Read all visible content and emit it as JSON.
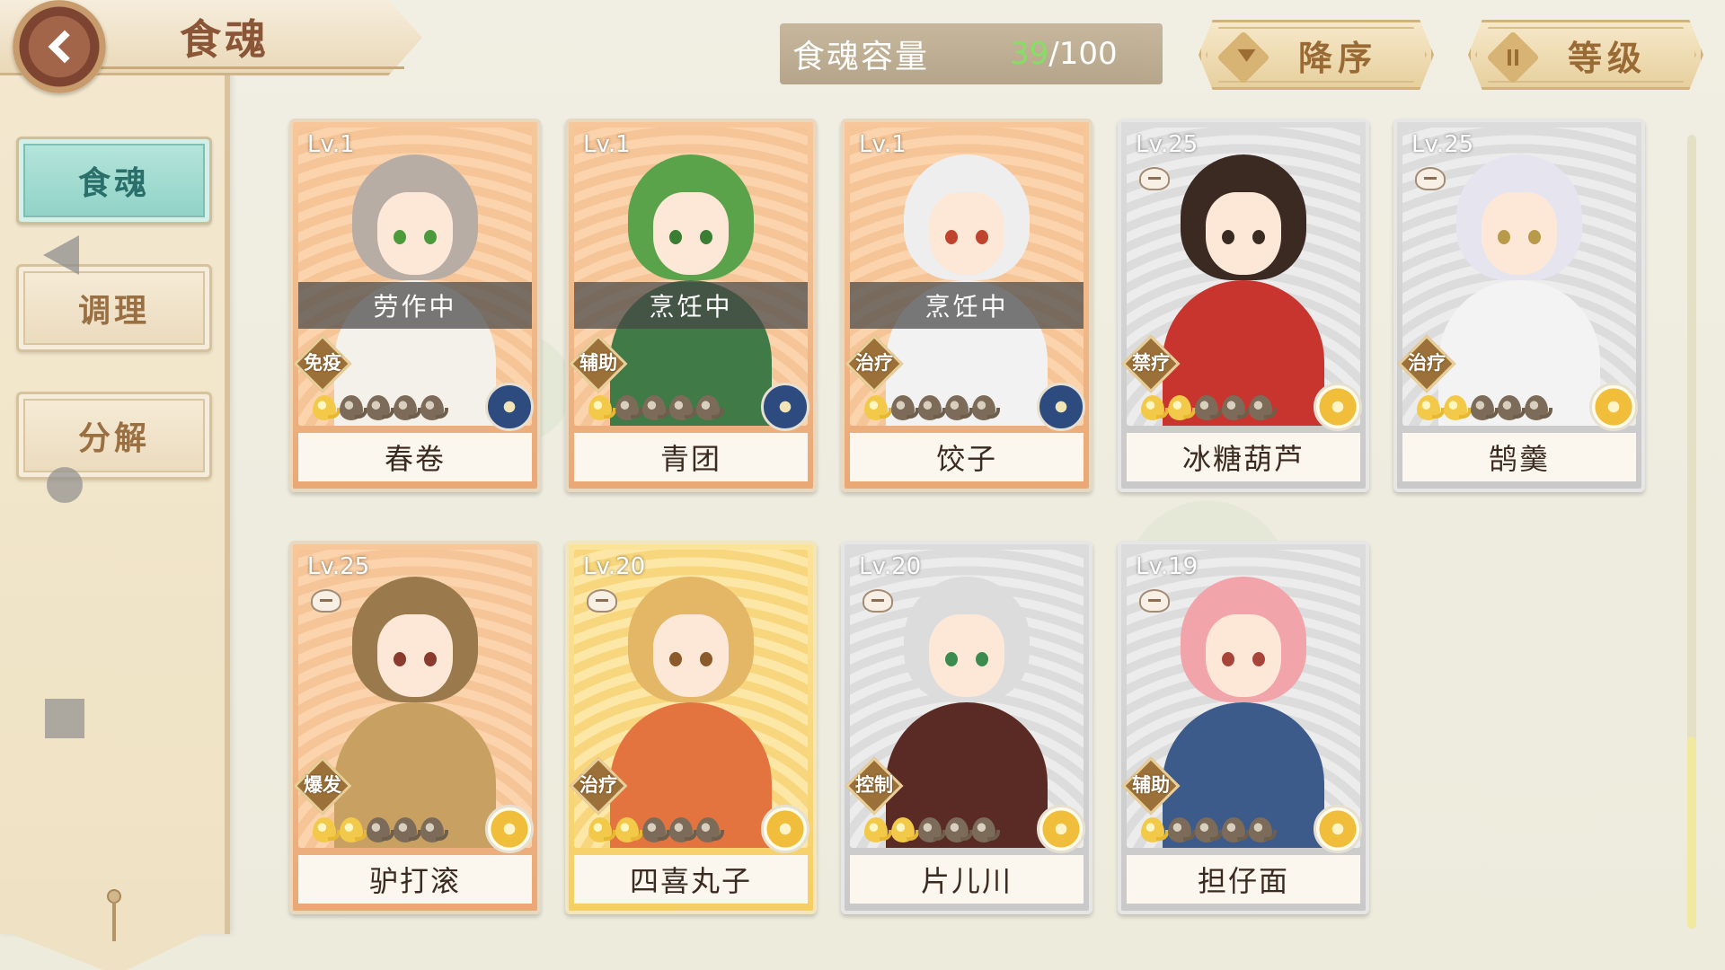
{
  "header": {
    "title": "食魂",
    "capacity_label": "食魂容量",
    "capacity_current": "39",
    "capacity_sep_max": "/100",
    "sort_label": "降序",
    "level_label": "等级"
  },
  "sidebar": {
    "items": [
      {
        "label": "食魂",
        "active": true
      },
      {
        "label": "调理",
        "active": false
      },
      {
        "label": "分解",
        "active": false
      }
    ]
  },
  "colors": {
    "accent_teal": "#8fd1c6",
    "capacity_green": "#7fe05c",
    "title_brown": "#8b5637"
  },
  "cards": [
    {
      "level": "Lv.1",
      "name": "春卷",
      "status": "劳作中",
      "role": "免疫",
      "stars_filled": 1,
      "stars_total": 5,
      "rarity": "orange",
      "emblem": "blue",
      "hair": "#b8ada4",
      "eye": "#4c9a3c",
      "body": "#f4f1ea"
    },
    {
      "level": "Lv.1",
      "name": "青团",
      "status": "烹饪中",
      "role": "辅助",
      "stars_filled": 1,
      "stars_total": 5,
      "rarity": "orange",
      "emblem": "blue",
      "hair": "#5aa34b",
      "eye": "#3b7d32",
      "body": "#3f7a47"
    },
    {
      "level": "Lv.1",
      "name": "饺子",
      "status": "烹饪中",
      "role": "治疗",
      "stars_filled": 1,
      "stars_total": 5,
      "rarity": "orange",
      "emblem": "blue",
      "hair": "#eeeeee",
      "eye": "#c0432e",
      "body": "#f2f2f2"
    },
    {
      "level": "Lv.25",
      "name": "冰糖葫芦",
      "status": "",
      "role": "禁疗",
      "stars_filled": 2,
      "stars_total": 5,
      "rarity": "gray",
      "emblem": "gold",
      "hair": "#3a2a22",
      "eye": "#3a2a22",
      "body": "#c8352e"
    },
    {
      "level": "Lv.25",
      "name": "鹄羹",
      "status": "",
      "role": "治疗",
      "stars_filled": 2,
      "stars_total": 5,
      "rarity": "gray",
      "emblem": "gold",
      "hair": "#e6e4ee",
      "eye": "#b79a4a",
      "body": "#f3f3f3"
    },
    {
      "level": "Lv.25",
      "name": "驴打滚",
      "status": "",
      "role": "爆发",
      "stars_filled": 2,
      "stars_total": 5,
      "rarity": "orange",
      "emblem": "gold",
      "hair": "#9a7a4c",
      "eye": "#8b3a2e",
      "body": "#c8a061"
    },
    {
      "level": "Lv.20",
      "name": "四喜丸子",
      "status": "",
      "role": "治疗",
      "stars_filled": 2,
      "stars_total": 5,
      "rarity": "gold",
      "emblem": "gold",
      "hair": "#e3b766",
      "eye": "#8b5a2b",
      "body": "#e4743f"
    },
    {
      "level": "Lv.20",
      "name": "片儿川",
      "status": "",
      "role": "控制",
      "stars_filled": 2,
      "stars_total": 5,
      "rarity": "gray",
      "emblem": "gold",
      "hair": "#dcdcdc",
      "eye": "#3b8a4e",
      "body": "#5a2a24"
    },
    {
      "level": "Lv.19",
      "name": "担仔面",
      "status": "",
      "role": "辅助",
      "stars_filled": 1,
      "stars_total": 5,
      "rarity": "gray",
      "emblem": "gold",
      "hair": "#f1a4a9",
      "eye": "#a8453b",
      "body": "#3d5b8a"
    }
  ]
}
